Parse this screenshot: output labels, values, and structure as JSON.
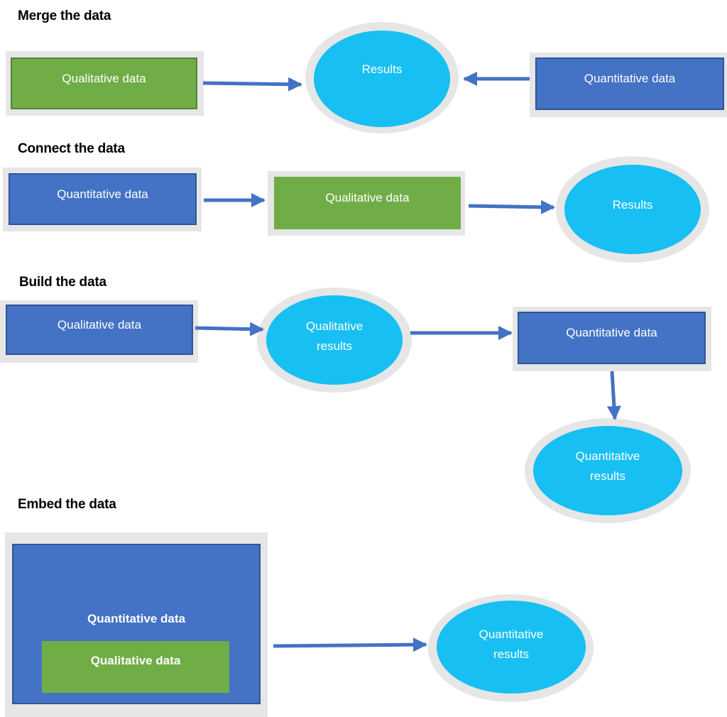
{
  "sections": {
    "merge": {
      "title": "Merge the data",
      "left_box": "Qualitative data",
      "center": "Results",
      "right_box": "Quantitative data"
    },
    "connect": {
      "title": "Connect the data",
      "box1": "Quantitative data",
      "box2": "Qualitative data",
      "result": "Results"
    },
    "build": {
      "title": "Build the data",
      "box1": "Qualitative data",
      "result1_line1": "Qualitative",
      "result1_line2": "results",
      "box2": "Quantitative data",
      "result2_line1": "Quantitative",
      "result2_line2": "results"
    },
    "embed": {
      "title": "Embed the data",
      "outer_box": "Quantitative data",
      "inner_box": "Qualitative data",
      "result_line1": "Quantitative",
      "result_line2": "results"
    }
  },
  "colors": {
    "quantitative_box": "#4472c4",
    "qualitative_box": "#70ad47",
    "result_ellipse": "#17bff2",
    "frame": "#e6e6e6",
    "arrow": "#4472c4"
  }
}
